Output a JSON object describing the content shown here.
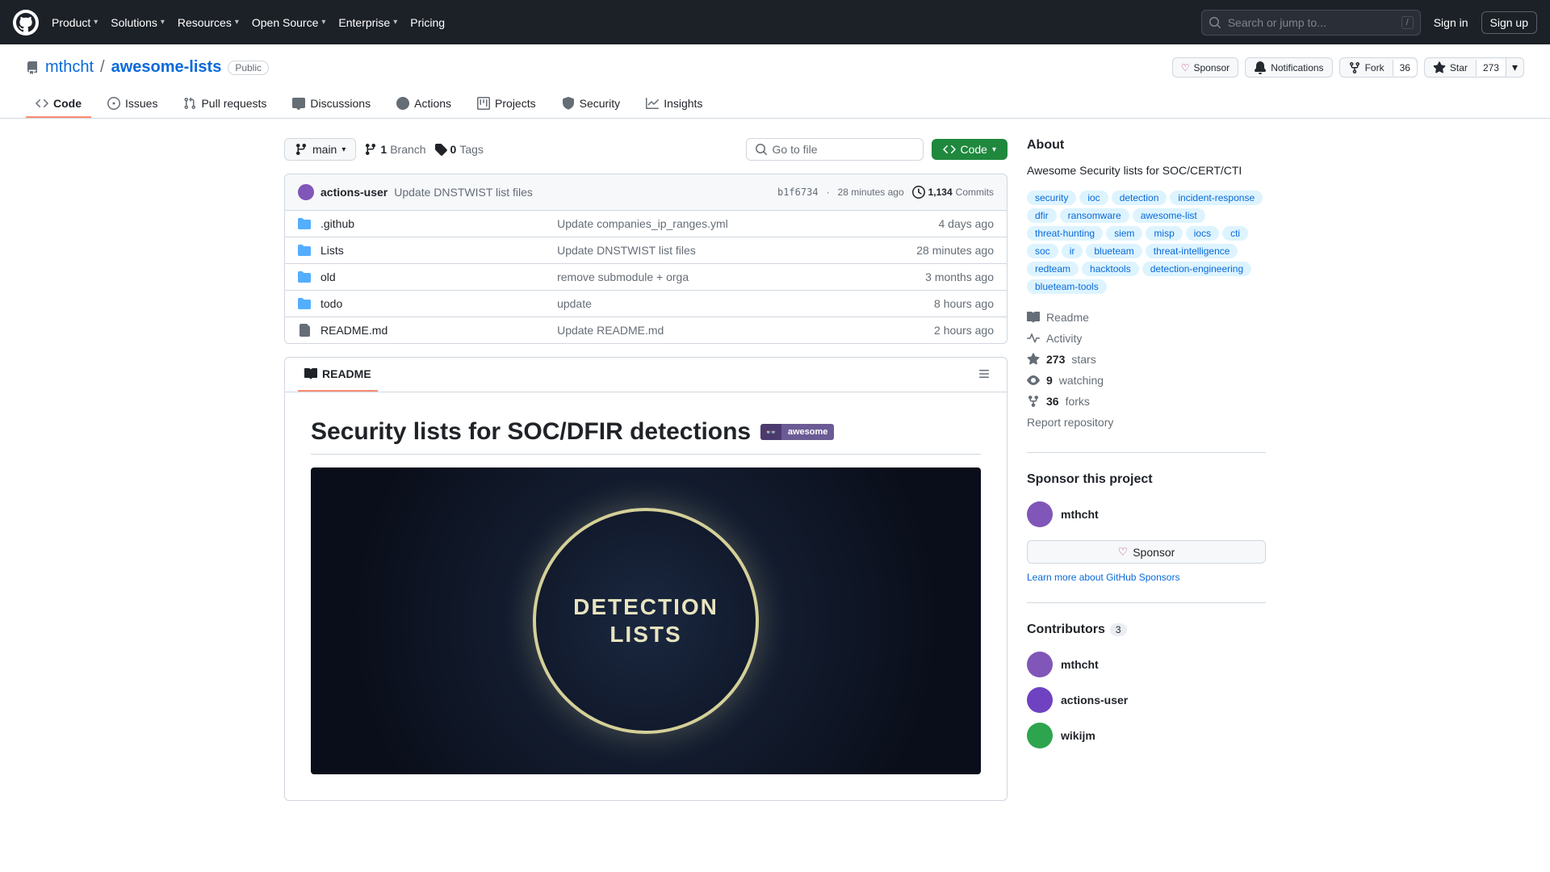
{
  "header": {
    "nav": [
      "Product",
      "Solutions",
      "Resources",
      "Open Source",
      "Enterprise",
      "Pricing"
    ],
    "search_placeholder": "Search or jump to...",
    "search_key": "/",
    "signin": "Sign in",
    "signup": "Sign up"
  },
  "repo": {
    "owner": "mthcht",
    "name": "awesome-lists",
    "visibility": "Public",
    "actions": {
      "sponsor": "Sponsor",
      "notifications": "Notifications",
      "fork": "Fork",
      "fork_count": "36",
      "star": "Star",
      "star_count": "273"
    }
  },
  "tabs": [
    "Code",
    "Issues",
    "Pull requests",
    "Discussions",
    "Actions",
    "Projects",
    "Security",
    "Insights"
  ],
  "file_header": {
    "branch": "main",
    "branch_count": "1",
    "branch_label": "Branch",
    "tag_count": "0",
    "tag_label": "Tags",
    "go_to_file": "Go to file",
    "code_btn": "Code"
  },
  "commit_bar": {
    "author": "actions-user",
    "message": "Update DNSTWIST list files",
    "hash": "b1f6734",
    "time": "28 minutes ago",
    "commits_count": "1,134",
    "commits_label": "Commits"
  },
  "files": [
    {
      "icon": "dir",
      "name": ".github",
      "msg": "Update companies_ip_ranges.yml",
      "date": "4 days ago"
    },
    {
      "icon": "dir",
      "name": "Lists",
      "msg": "Update DNSTWIST list files",
      "date": "28 minutes ago"
    },
    {
      "icon": "dir",
      "name": "old",
      "msg": "remove submodule + orga",
      "date": "3 months ago"
    },
    {
      "icon": "dir",
      "name": "todo",
      "msg": "update",
      "date": "8 hours ago"
    },
    {
      "icon": "file",
      "name": "README.md",
      "msg": "Update README.md",
      "date": "2 hours ago"
    }
  ],
  "readme": {
    "tab": "README",
    "title": "Security lists for SOC/DFIR detections",
    "awesome_badge": "awesome",
    "hero_text_1": "DETECTION",
    "hero_text_2": "LISTS"
  },
  "about": {
    "heading": "About",
    "description": "Awesome Security lists for SOC/CERT/CTI",
    "topics": [
      "security",
      "ioc",
      "detection",
      "incident-response",
      "dfir",
      "ransomware",
      "awesome-list",
      "threat-hunting",
      "siem",
      "misp",
      "iocs",
      "cti",
      "soc",
      "ir",
      "blueteam",
      "threat-intelligence",
      "redteam",
      "hacktools",
      "detection-engineering",
      "blueteam-tools"
    ],
    "links": {
      "readme": "Readme",
      "activity": "Activity",
      "stars_n": "273",
      "stars": "stars",
      "watching_n": "9",
      "watching": "watching",
      "forks_n": "36",
      "forks": "forks",
      "report": "Report repository"
    }
  },
  "sponsor_section": {
    "heading": "Sponsor this project",
    "user": "mthcht",
    "button": "Sponsor",
    "learn": "Learn more about GitHub Sponsors"
  },
  "contributors": {
    "heading": "Contributors",
    "count": "3",
    "list": [
      "mthcht",
      "actions-user",
      "wikijm"
    ]
  }
}
